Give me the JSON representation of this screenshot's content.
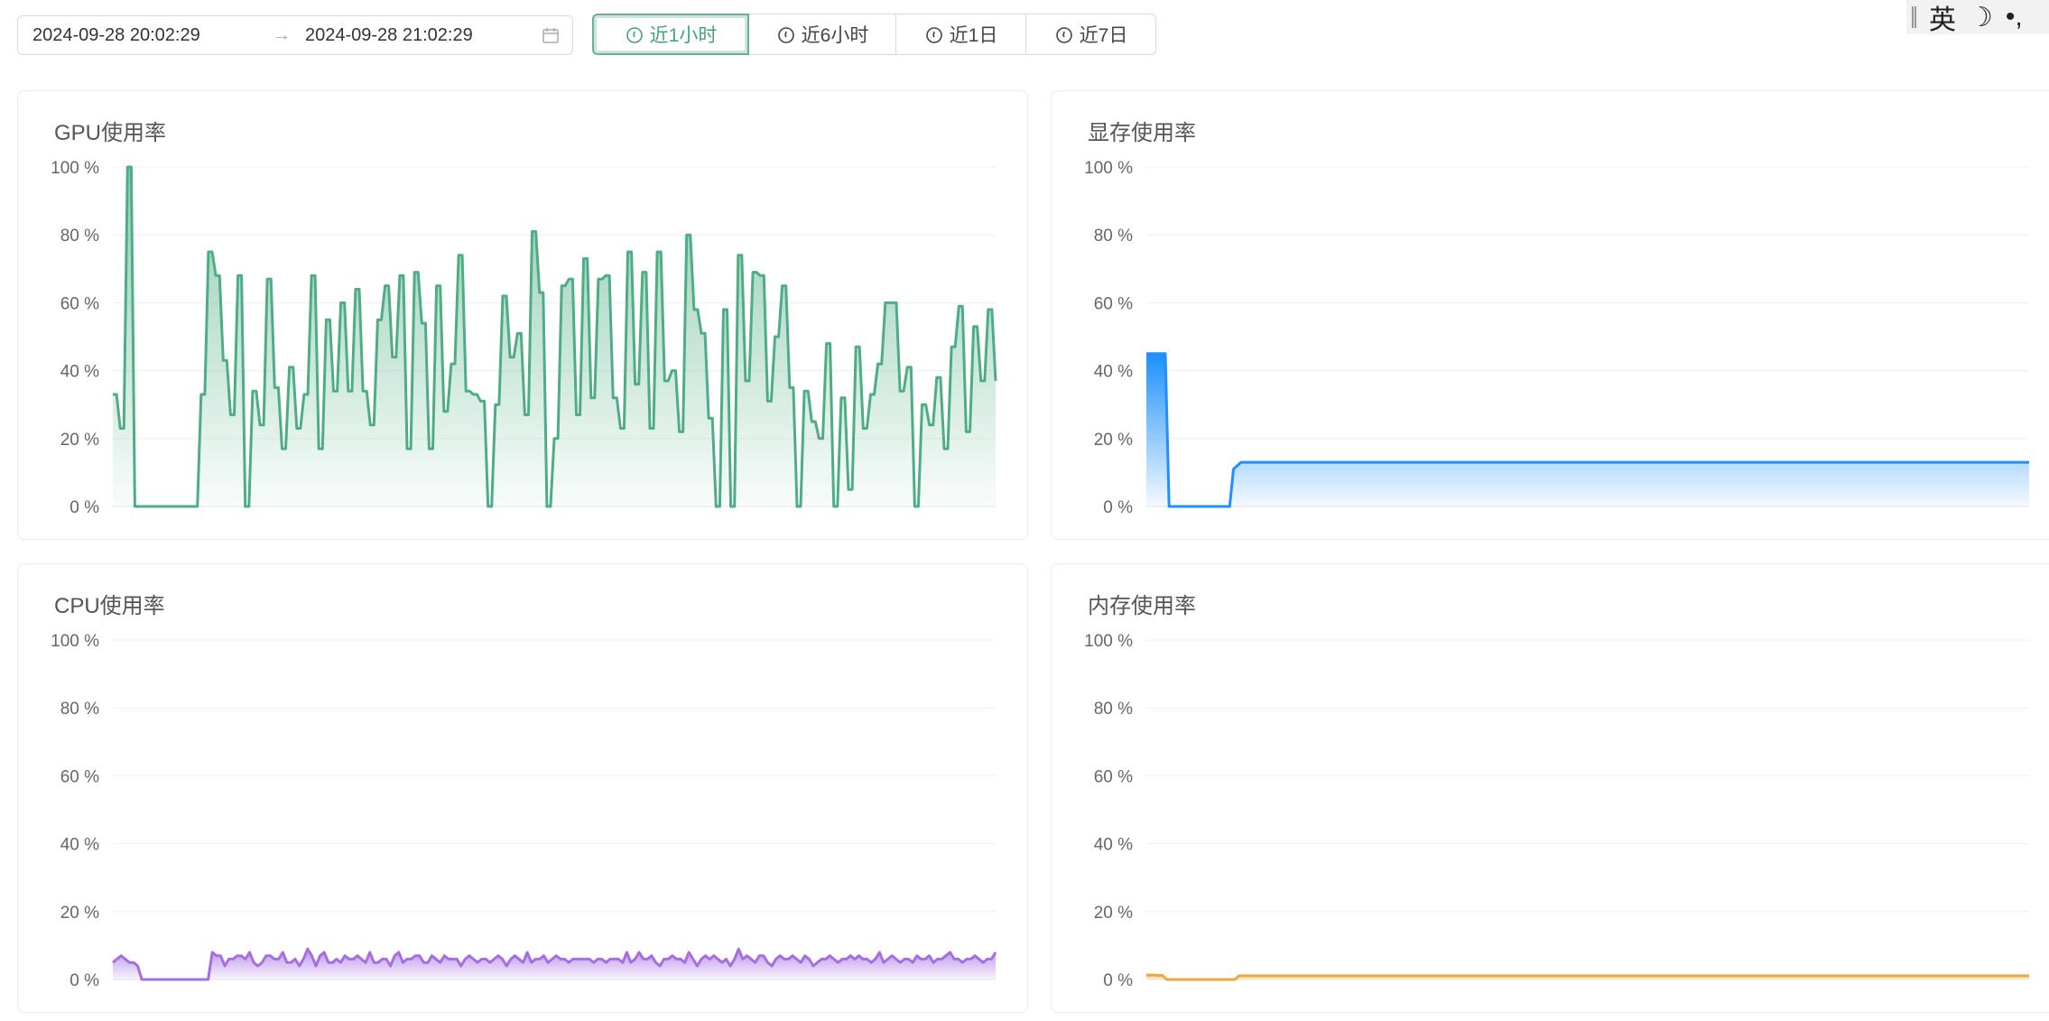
{
  "range": {
    "start": "2024-09-28 20:02:29",
    "end": "2024-09-28 21:02:29",
    "separator": "→"
  },
  "quick_ranges": [
    {
      "label": "近1小时",
      "active": true
    },
    {
      "label": "近6小时",
      "active": false
    },
    {
      "label": "近1日",
      "active": false
    },
    {
      "label": "近7日",
      "active": false
    }
  ],
  "ime": {
    "mode": "英",
    "moon": "☽",
    "punct": "•,"
  },
  "colors": {
    "gpu": "#4fad86",
    "vram": "#1e90ff",
    "cpu": "#a86ee0",
    "mem": "#e9a93c"
  },
  "chart_data": [
    {
      "type": "area",
      "title": "GPU使用率",
      "yticks": [
        "100 %",
        "80 %",
        "60 %",
        "40 %",
        "20 %",
        "0 %"
      ],
      "ylim": [
        0,
        100
      ],
      "grid": true,
      "values": [
        33,
        33,
        23,
        23,
        100,
        100,
        0,
        0,
        0,
        0,
        0,
        0,
        0,
        0,
        0,
        0,
        0,
        0,
        0,
        0,
        0,
        0,
        0,
        0,
        33,
        33,
        75,
        75,
        68,
        68,
        43,
        43,
        27,
        27,
        68,
        68,
        0,
        0,
        34,
        34,
        24,
        24,
        67,
        67,
        35,
        35,
        17,
        17,
        41,
        41,
        23,
        23,
        33,
        33,
        68,
        68,
        17,
        17,
        55,
        55,
        34,
        34,
        60,
        60,
        34,
        34,
        64,
        64,
        34,
        34,
        24,
        24,
        55,
        55,
        65,
        65,
        44,
        44,
        68,
        68,
        17,
        17,
        69,
        69,
        54,
        54,
        17,
        17,
        65,
        65,
        28,
        28,
        42,
        42,
        74,
        74,
        34,
        34,
        33,
        33,
        31,
        31,
        0,
        0,
        30,
        30,
        62,
        62,
        44,
        44,
        51,
        51,
        27,
        27,
        81,
        81,
        63,
        63,
        0,
        0,
        20,
        20,
        65,
        65,
        67,
        67,
        27,
        27,
        73,
        73,
        32,
        32,
        67,
        67,
        68,
        68,
        32,
        32,
        23,
        23,
        75,
        75,
        36,
        36,
        69,
        69,
        23,
        23,
        75,
        75,
        37,
        37,
        40,
        40,
        22,
        22,
        80,
        80,
        58,
        58,
        51,
        51,
        26,
        26,
        0,
        0,
        58,
        58,
        0,
        0,
        74,
        74,
        37,
        37,
        69,
        69,
        68,
        68,
        31,
        31,
        50,
        50,
        65,
        65,
        35,
        35,
        0,
        0,
        34,
        34,
        25,
        25,
        20,
        20,
        48,
        48,
        0,
        0,
        32,
        32,
        5,
        5,
        47,
        47,
        23,
        23,
        33,
        33,
        42,
        42,
        60,
        60,
        60,
        60,
        34,
        34,
        41,
        41,
        0,
        0,
        30,
        30,
        24,
        24,
        38,
        38,
        17,
        17,
        47,
        47,
        59,
        59,
        22,
        22,
        53,
        53,
        37,
        37,
        58,
        58,
        37
      ]
    },
    {
      "type": "area",
      "title": "显存使用率",
      "yticks": [
        "100 %",
        "80 %",
        "60 %",
        "40 %",
        "20 %",
        "0 %"
      ],
      "ylim": [
        0,
        100
      ],
      "grid": true,
      "values": [
        45,
        45,
        45,
        45,
        45,
        45,
        0,
        0,
        0,
        0,
        0,
        0,
        0,
        0,
        0,
        0,
        0,
        0,
        0,
        0,
        0,
        0,
        0,
        11,
        12,
        13,
        13,
        13,
        13,
        13,
        13,
        13,
        13,
        13,
        13,
        13,
        13,
        13,
        13,
        13,
        13,
        13,
        13,
        13,
        13,
        13,
        13,
        13,
        13,
        13,
        13,
        13,
        13,
        13,
        13,
        13,
        13,
        13,
        13,
        13,
        13,
        13,
        13,
        13,
        13,
        13,
        13,
        13,
        13,
        13,
        13,
        13,
        13,
        13,
        13,
        13,
        13,
        13,
        13,
        13,
        13,
        13,
        13,
        13,
        13,
        13,
        13,
        13,
        13,
        13,
        13,
        13,
        13,
        13,
        13,
        13,
        13,
        13,
        13,
        13,
        13,
        13,
        13,
        13,
        13,
        13,
        13,
        13,
        13,
        13,
        13,
        13,
        13,
        13,
        13,
        13,
        13,
        13,
        13,
        13,
        13,
        13,
        13,
        13,
        13,
        13,
        13,
        13,
        13,
        13,
        13,
        13,
        13,
        13,
        13,
        13,
        13,
        13,
        13,
        13,
        13,
        13,
        13,
        13,
        13,
        13,
        13,
        13,
        13,
        13,
        13,
        13,
        13,
        13,
        13,
        13,
        13,
        13,
        13,
        13,
        13,
        13,
        13,
        13,
        13,
        13,
        13,
        13,
        13,
        13,
        13,
        13,
        13,
        13,
        13,
        13,
        13,
        13,
        13,
        13,
        13,
        13,
        13,
        13,
        13,
        13,
        13,
        13,
        13,
        13,
        13,
        13,
        13,
        13,
        13,
        13,
        13,
        13,
        13,
        13,
        13,
        13,
        13,
        13,
        13,
        13,
        13,
        13,
        13,
        13,
        13,
        13,
        13,
        13,
        13,
        13,
        13,
        13,
        13,
        13,
        13,
        13,
        13,
        13,
        13,
        13,
        13,
        13,
        13,
        13,
        13,
        13,
        13,
        13
      ]
    },
    {
      "type": "area",
      "title": "CPU使用率",
      "yticks": [
        "100 %",
        "80 %",
        "60 %",
        "40 %",
        "20 %",
        "0 %"
      ],
      "ylim": [
        0,
        100
      ],
      "grid": true,
      "values": [
        5,
        6,
        7,
        6,
        5,
        5,
        4,
        0,
        0,
        0,
        0,
        0,
        0,
        0,
        0,
        0,
        0,
        0,
        0,
        0,
        0,
        0,
        0,
        0,
        8,
        7,
        7,
        4,
        6,
        6,
        7,
        7,
        6,
        8,
        5,
        4,
        5,
        7,
        7,
        6,
        6,
        8,
        5,
        5,
        6,
        4,
        6,
        9,
        7,
        4,
        7,
        8,
        5,
        5,
        6,
        5,
        7,
        6,
        6,
        7,
        6,
        5,
        8,
        5,
        5,
        6,
        6,
        4,
        7,
        8,
        5,
        6,
        6,
        7,
        7,
        5,
        5,
        7,
        6,
        5,
        7,
        6,
        6,
        6,
        4,
        6,
        7,
        6,
        5,
        6,
        6,
        5,
        6,
        7,
        6,
        4,
        6,
        7,
        6,
        5,
        8,
        5,
        6,
        6,
        7,
        5,
        6,
        7,
        6,
        6,
        5,
        6,
        6,
        6,
        6,
        6,
        5,
        6,
        6,
        5,
        6,
        6,
        6,
        5,
        8,
        5,
        6,
        8,
        6,
        6,
        7,
        5,
        4,
        6,
        6,
        7,
        6,
        6,
        5,
        8,
        6,
        4,
        6,
        7,
        6,
        7,
        6,
        5,
        6,
        4,
        6,
        9,
        6,
        7,
        6,
        5,
        7,
        7,
        5,
        4,
        6,
        7,
        6,
        6,
        7,
        6,
        5,
        7,
        6,
        4,
        5,
        6,
        6,
        7,
        6,
        5,
        6,
        6,
        7,
        6,
        7,
        6,
        6,
        5,
        6,
        8,
        5,
        6,
        7,
        6,
        5,
        6,
        6,
        5,
        7,
        6,
        6,
        7,
        5,
        6,
        6,
        7,
        8,
        6,
        6,
        5,
        6,
        6,
        7,
        6,
        5,
        6,
        6,
        8
      ]
    },
    {
      "type": "area",
      "title": "内存使用率",
      "yticks": [
        "100 %",
        "80 %",
        "60 %",
        "40 %",
        "20 %",
        "0 %"
      ],
      "ylim": [
        0,
        100
      ],
      "grid": true,
      "values": [
        1.3,
        1.3,
        1.3,
        1.2,
        1.2,
        0,
        0,
        0,
        0,
        0,
        0,
        0,
        0,
        0,
        0,
        0,
        0,
        0,
        0,
        0,
        0,
        0,
        0,
        1.1,
        1.1,
        1.1,
        1.1,
        1.1,
        1.1,
        1.1,
        1.1,
        1.1,
        1.1,
        1.1,
        1.1,
        1.1,
        1.1,
        1.1,
        1.1,
        1.1,
        1.1,
        1.1,
        1.1,
        1.1,
        1.1,
        1.1,
        1.1,
        1.1,
        1.1,
        1.1,
        1.1,
        1.1,
        1.1,
        1.1,
        1.1,
        1.1,
        1.1,
        1.1,
        1.1,
        1.1,
        1.1,
        1.1,
        1.1,
        1.1,
        1.1,
        1.1,
        1.1,
        1.1,
        1.1,
        1.1,
        1.1,
        1.1,
        1.1,
        1.1,
        1.1,
        1.1,
        1.1,
        1.1,
        1.1,
        1.1,
        1.1,
        1.1,
        1.1,
        1.1,
        1.1,
        1.1,
        1.1,
        1.1,
        1.1,
        1.1,
        1.1,
        1.1,
        1.1,
        1.1,
        1.1,
        1.1,
        1.1,
        1.1,
        1.1,
        1.1,
        1.1,
        1.1,
        1.1,
        1.1,
        1.1,
        1.1,
        1.1,
        1.1,
        1.1,
        1.1,
        1.1,
        1.1,
        1.1,
        1.1,
        1.1,
        1.1,
        1.1,
        1.1,
        1.1,
        1.1,
        1.1,
        1.1,
        1.1,
        1.1,
        1.1,
        1.1,
        1.1,
        1.1,
        1.1,
        1.1,
        1.1,
        1.1,
        1.1,
        1.1,
        1.1,
        1.1,
        1.1,
        1.1,
        1.1,
        1.1,
        1.1,
        1.1,
        1.1,
        1.1,
        1.1,
        1.1,
        1.1,
        1.1,
        1.1,
        1.1,
        1.1,
        1.1,
        1.1,
        1.1,
        1.1,
        1.1,
        1.1,
        1.1,
        1.1,
        1.1,
        1.1,
        1.1,
        1.1,
        1.1,
        1.1,
        1.1,
        1.1,
        1.1,
        1.1,
        1.1,
        1.1,
        1.1,
        1.1,
        1.1,
        1.1,
        1.1,
        1.1,
        1.1,
        1.1,
        1.1,
        1.1,
        1.1,
        1.1,
        1.1,
        1.1,
        1.1,
        1.1,
        1.1,
        1.1,
        1.1,
        1.1,
        1.1,
        1.1,
        1.1,
        1.1,
        1.1,
        1.1,
        1.1,
        1.1,
        1.1,
        1.1,
        1.1,
        1.1,
        1.1,
        1.1,
        1.1,
        1.1,
        1.1,
        1.1,
        1.1,
        1.1,
        1.1,
        1.1,
        1.1,
        1.1,
        1.1,
        1.1,
        1.1,
        1.1,
        1.1
      ]
    }
  ]
}
